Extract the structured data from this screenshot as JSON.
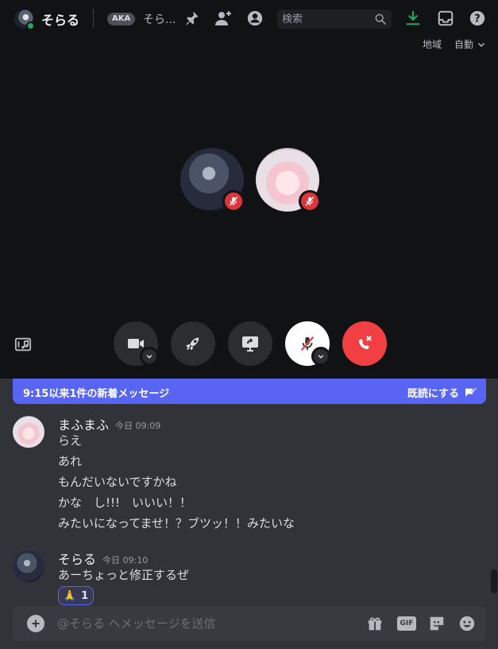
{
  "header": {
    "title": "そらる",
    "aka_badge": "AKA",
    "aka_name": "そら...",
    "search_placeholder": "検索",
    "icons": [
      "pin-icon",
      "add-friend-icon",
      "profile-icon",
      "search-icon",
      "download-icon",
      "inbox-icon",
      "help-icon"
    ]
  },
  "stage": {
    "region_label": "地域",
    "region_value": "自動",
    "participants": [
      "そらる",
      "まふまふ"
    ],
    "controls": [
      "camera",
      "activity",
      "screen-share",
      "microphone",
      "disconnect"
    ]
  },
  "new_messages": {
    "text": "9:15以来1件の新着メッセージ",
    "mark_read": "既読にする"
  },
  "messages": [
    {
      "author": "まふまふ",
      "timestamp": "今日 09:09",
      "lines": [
        "らえ",
        "あれ",
        "もんだいないですかね",
        "かな　し!!!　いいい！！",
        "みたいになってませ！？ブツッ！！みたいな"
      ]
    },
    {
      "author": "そらる",
      "timestamp": "今日 09:10",
      "lines": [
        "あーちょっと修正するぜ"
      ],
      "reaction": {
        "emoji": "🙏",
        "count": "1"
      }
    }
  ],
  "composer": {
    "placeholder": "@そらる へメッセージを送信",
    "gif_label": "GIF"
  },
  "colors": {
    "brand": "#5865f2",
    "danger": "#f23f43",
    "online": "#23a55a",
    "download": "#23a55a"
  }
}
